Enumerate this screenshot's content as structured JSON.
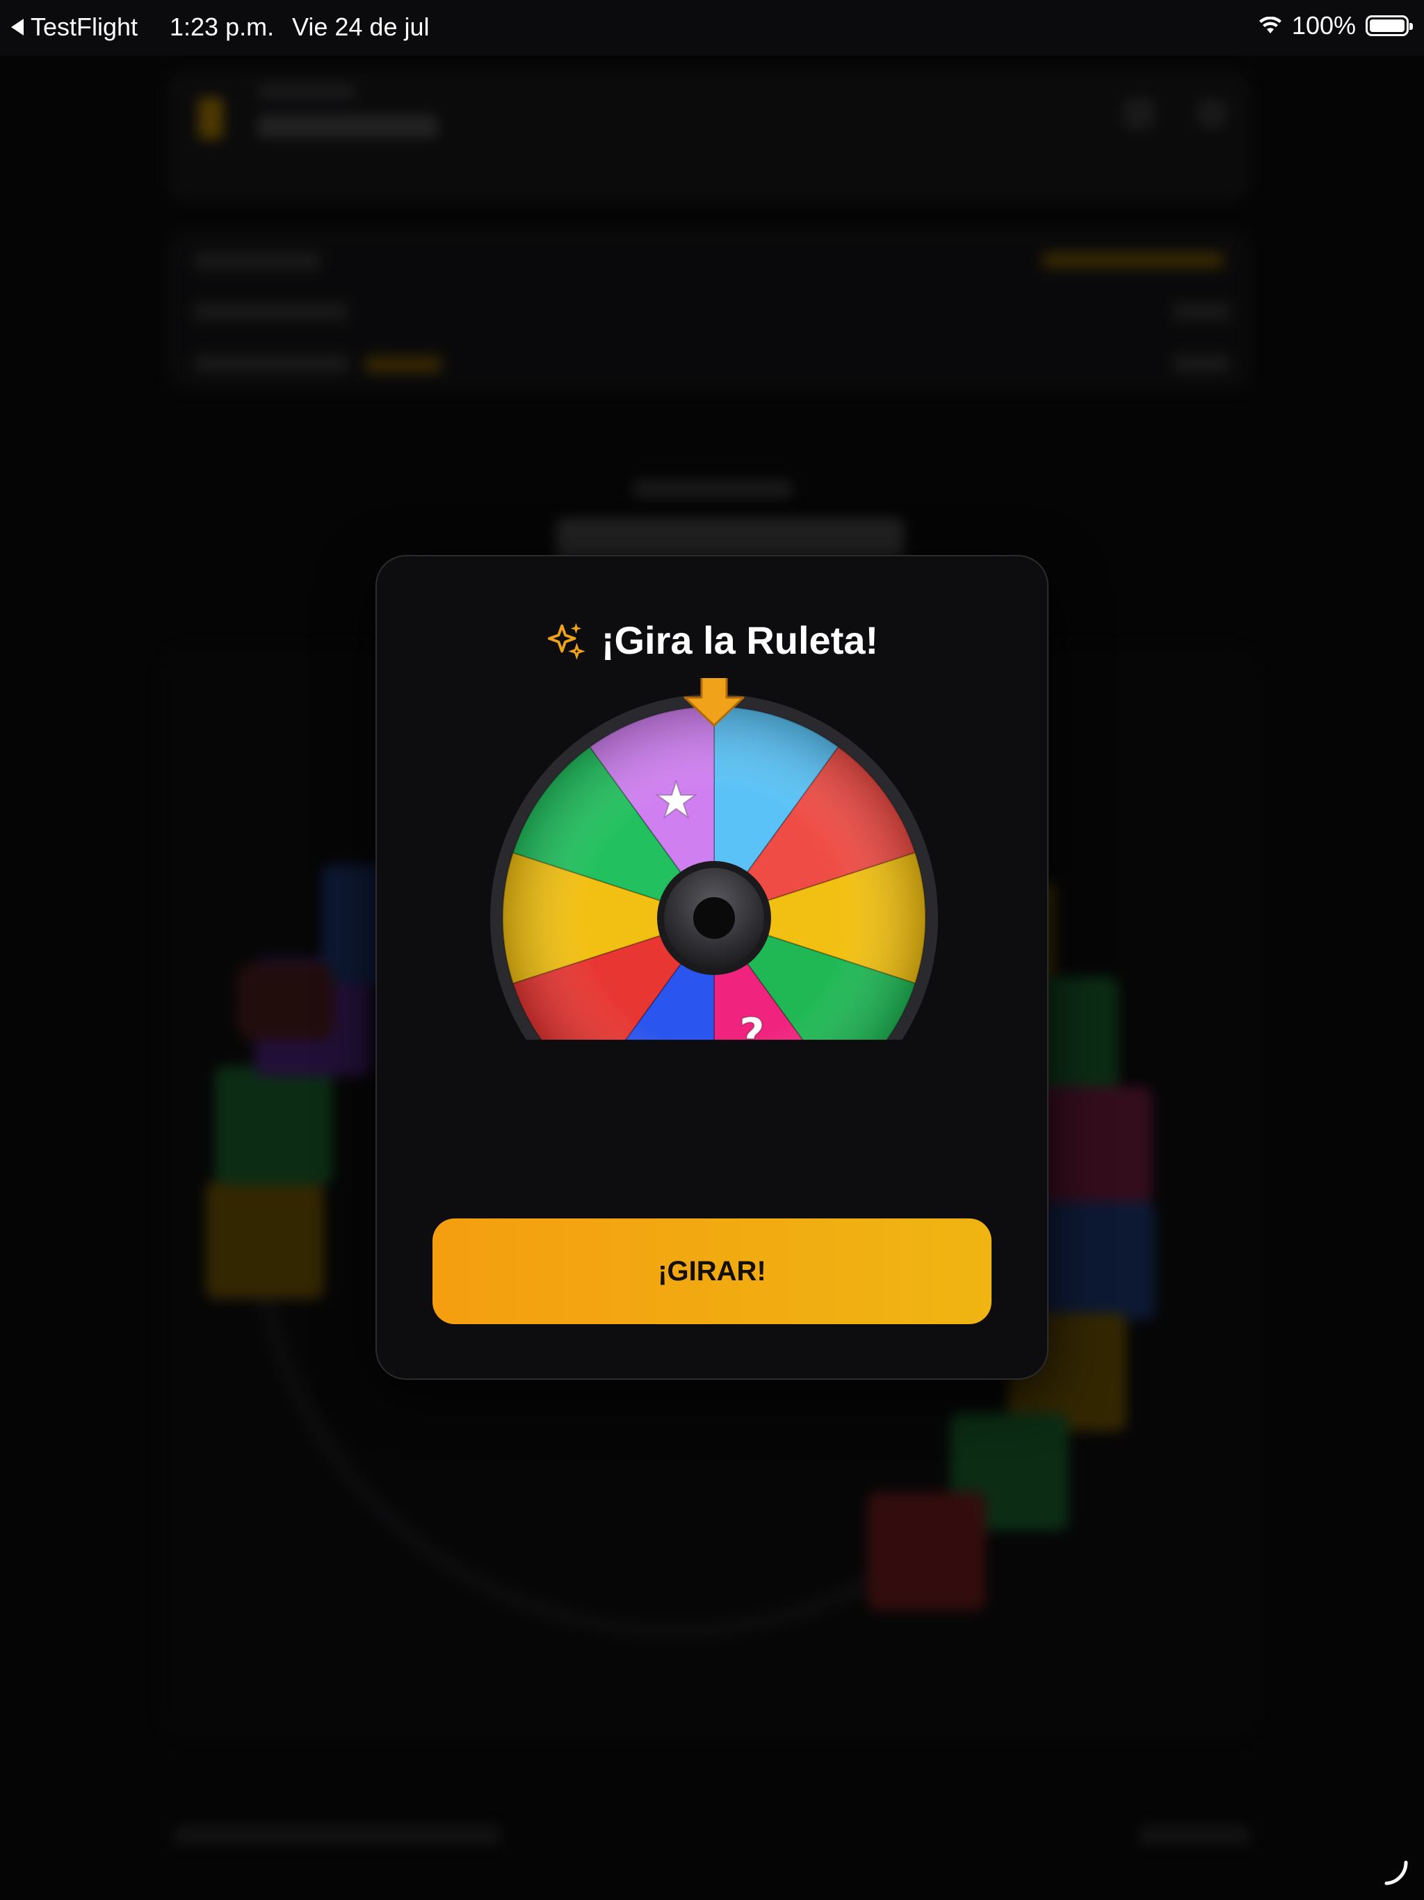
{
  "status_bar": {
    "back_app": "TestFlight",
    "time": "1:23 p.m.",
    "date": "Vie 24 de jul",
    "battery": "100%",
    "battery_level": 1.0
  },
  "modal": {
    "title": "¡Gira la Ruleta!",
    "spin_button": "¡GIRAR!",
    "icons": {
      "title": "sparkles-icon",
      "pointer": "arrow-down-icon",
      "star_segment": "star-icon"
    },
    "wheel": {
      "segments": [
        {
          "color": "#5ac2f6",
          "symbol": ""
        },
        {
          "color": "#ef4c45",
          "symbol": ""
        },
        {
          "color": "#f2c012",
          "symbol": ""
        },
        {
          "color": "#1fb855",
          "symbol": ""
        },
        {
          "color": "#f0247e",
          "symbol": "?"
        },
        {
          "color": "#2a55ee",
          "symbol": ""
        },
        {
          "color": "#e83632",
          "symbol": ""
        },
        {
          "color": "#f2c012",
          "symbol": ""
        },
        {
          "color": "#22c05e",
          "symbol": ""
        },
        {
          "color": "#cf7ff0",
          "symbol": "★"
        }
      ],
      "pointer_color": "#f0a21a",
      "rim_color": "#2a2a2e",
      "hub_color": "#3a3a3e"
    }
  },
  "colors": {
    "accent": "#f2a814",
    "modal_bg": "#0d0d0f",
    "screen_bg": "#050505"
  }
}
